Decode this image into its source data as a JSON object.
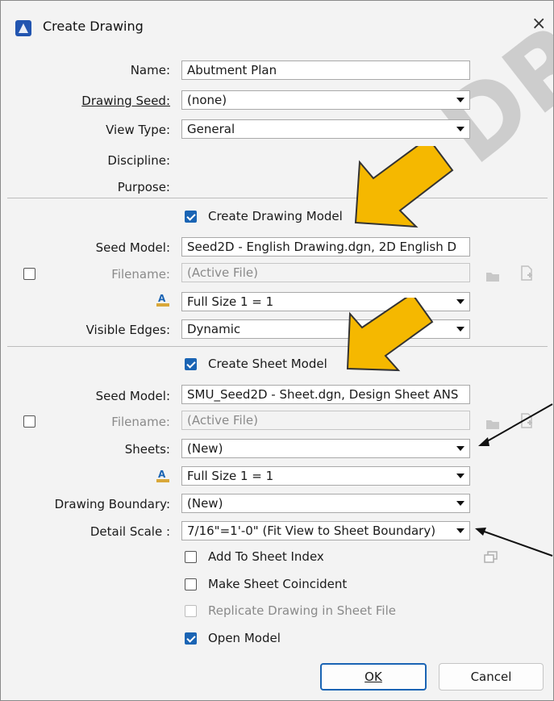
{
  "window": {
    "title": "Create Drawing",
    "close_glyph": "×"
  },
  "fields": {
    "name": {
      "label": "Name:",
      "value": "Abutment Plan"
    },
    "drawing_seed": {
      "label": "Drawing Seed:",
      "value": "(none)"
    },
    "view_type": {
      "label": "View Type:",
      "value": "General"
    },
    "discipline": {
      "label": "Discipline:"
    },
    "purpose": {
      "label": "Purpose:"
    }
  },
  "drawing_model": {
    "create_label": "Create Drawing Model",
    "seed_model_label": "Seed Model:",
    "seed_model_value": "Seed2D - English Drawing.dgn, 2D English D",
    "filename_label": "Filename:",
    "filename_value": "(Active File)",
    "annotation_scale_value": "Full Size 1 = 1",
    "visible_edges_label": "Visible Edges:",
    "visible_edges_value": "Dynamic"
  },
  "sheet_model": {
    "create_label": "Create Sheet Model",
    "seed_model_label": "Seed Model:",
    "seed_model_value": "SMU_Seed2D - Sheet.dgn, Design Sheet ANS",
    "filename_label": "Filename:",
    "filename_value": "(Active File)",
    "sheets_label": "Sheets:",
    "sheets_value": "(New)",
    "annotation_scale_value": "Full Size 1 = 1",
    "drawing_boundary_label": "Drawing Boundary:",
    "drawing_boundary_value": "(New)",
    "detail_scale_label": "Detail Scale :",
    "detail_scale_value": "7/16\"=1'-0\" (Fit View to Sheet Boundary)"
  },
  "options": {
    "add_to_sheet_index": "Add To Sheet Index",
    "make_sheet_coincident": "Make Sheet Coincident",
    "replicate_drawing": "Replicate Drawing in Sheet File",
    "open_model": "Open Model"
  },
  "buttons": {
    "ok": "OK",
    "cancel": "Cancel"
  },
  "watermark": "DRAFT",
  "colors": {
    "accent": "#1a64b4",
    "arrow_yellow": "#f5b800"
  }
}
